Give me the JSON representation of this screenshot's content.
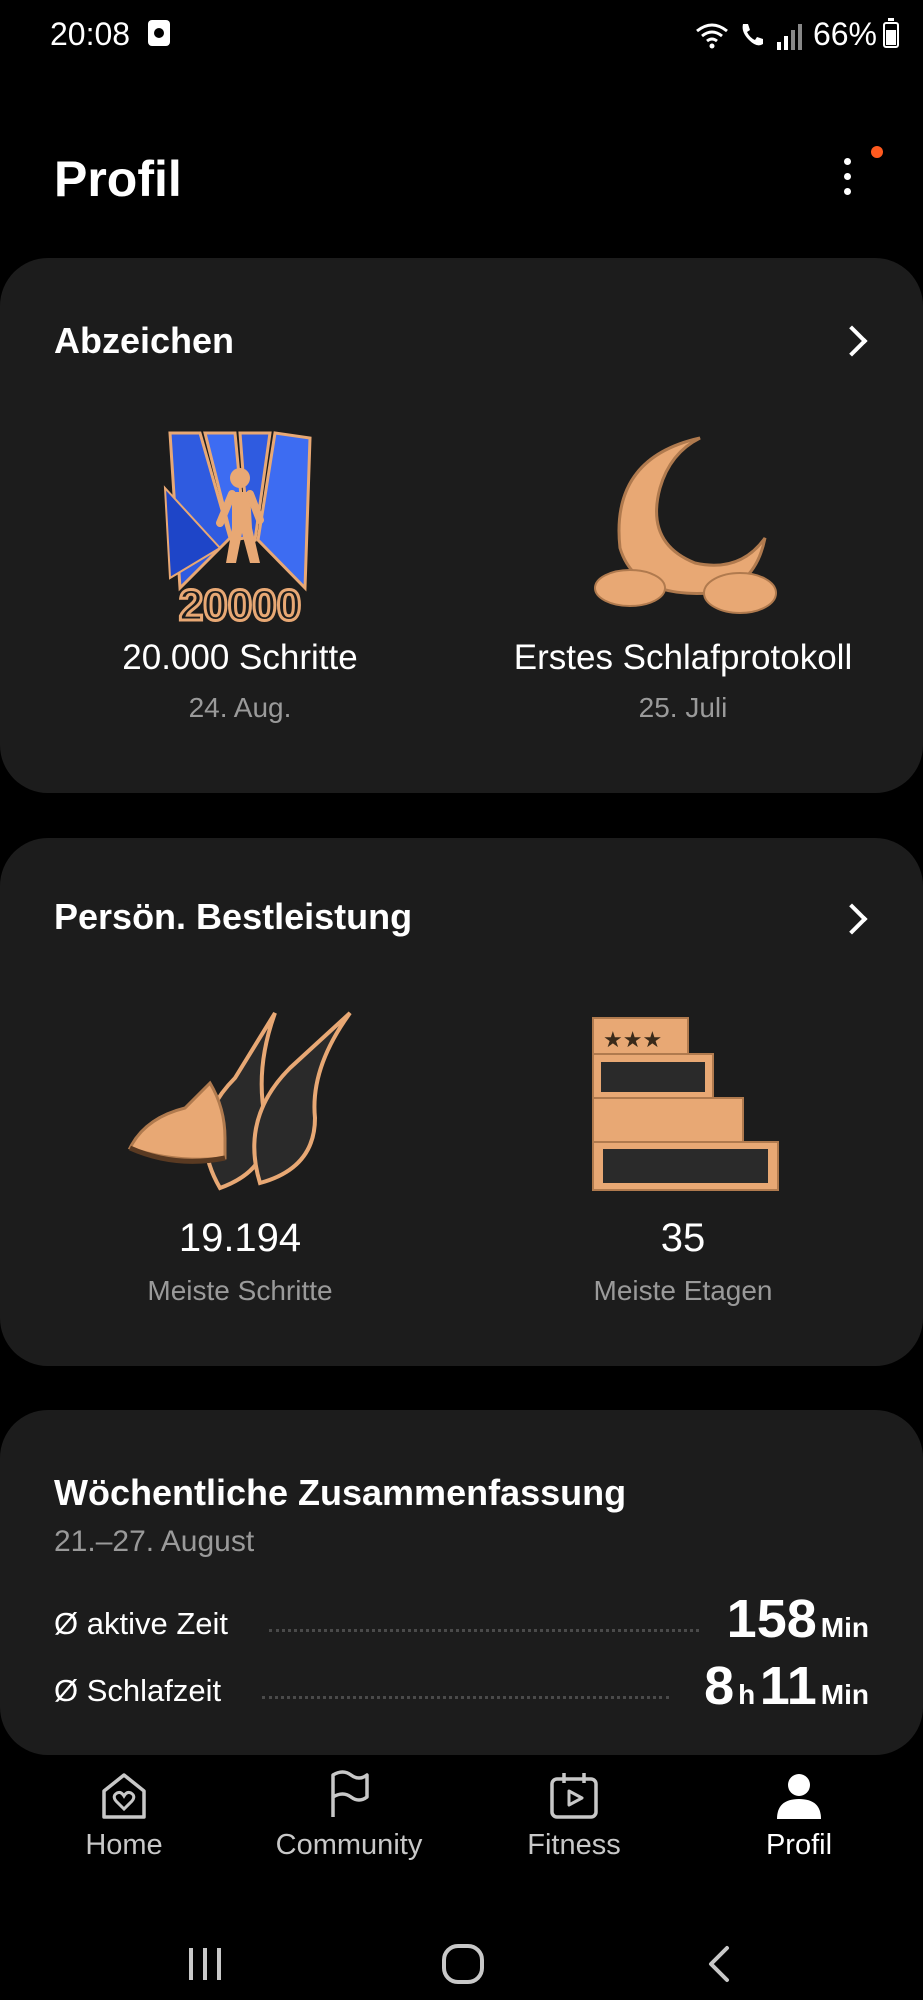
{
  "status_bar": {
    "time": "20:08",
    "battery": "66%",
    "battery_level": 0.66
  },
  "header": {
    "title": "Profil"
  },
  "badges": {
    "title": "Abzeichen",
    "items": [
      {
        "name": "20.000 Schritte",
        "date": "24. Aug.",
        "icon": "walker-20000-badge-icon",
        "badge_text": "20000"
      },
      {
        "name": "Erstes Schlafprotokoll",
        "date": "25. Juli",
        "icon": "moon-badge-icon"
      }
    ]
  },
  "records": {
    "title": "Persön. Bestleistung",
    "items": [
      {
        "value": "19.194",
        "label": "Meiste Schritte",
        "icon": "shoe-record-icon"
      },
      {
        "value": "35",
        "label": "Meiste Etagen",
        "icon": "stairs-record-icon"
      }
    ]
  },
  "summary": {
    "title": "Wöchentliche Zusammenfassung",
    "range": "21.–27. August",
    "rows": [
      {
        "label": "Ø aktive Zeit",
        "value": "158",
        "unit": "Min"
      },
      {
        "label": "Ø Schlafzeit",
        "value_h": "8",
        "unit_h": "h",
        "value_m": "11",
        "unit_m": "Min"
      }
    ]
  },
  "nav": [
    {
      "label": "Home",
      "icon": "home-heart-icon"
    },
    {
      "label": "Community",
      "icon": "flag-icon"
    },
    {
      "label": "Fitness",
      "icon": "calendar-play-icon"
    },
    {
      "label": "Profil",
      "icon": "person-icon",
      "active": true
    }
  ],
  "colors": {
    "card": "#1c1c1c",
    "accent_dot": "#ff5a1f",
    "gold": "#e8a874",
    "blue": "#2f5be0"
  }
}
